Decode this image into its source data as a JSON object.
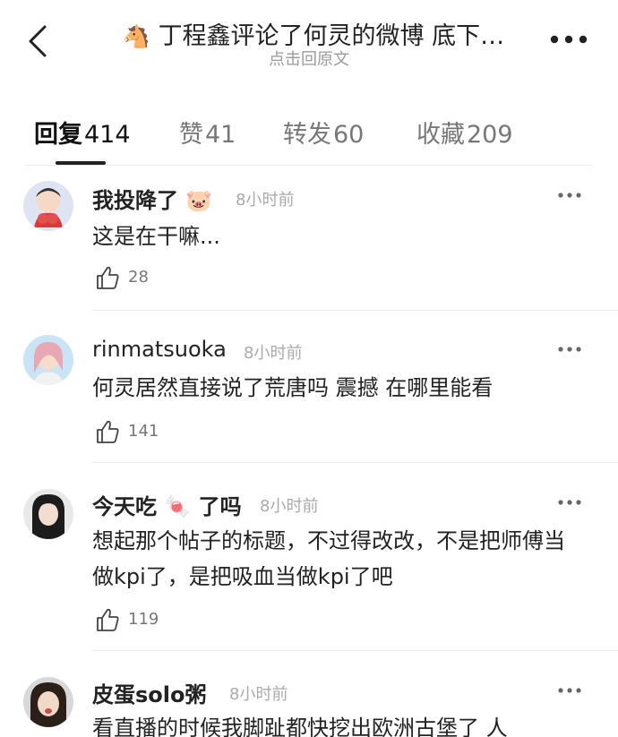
{
  "header": {
    "title_emoji": "🐴",
    "title": "丁程鑫评论了何灵的微博 底下…",
    "subtitle": "点击回原文"
  },
  "tabs": [
    {
      "label": "回复",
      "count": "414",
      "active": true
    },
    {
      "label": "赞",
      "count": "41",
      "active": false
    },
    {
      "label": "转发",
      "count": "60",
      "active": false
    },
    {
      "label": "收藏",
      "count": "209",
      "active": false
    }
  ],
  "comments": [
    {
      "user": "我投降了",
      "user_emoji": "🐷",
      "time": "8小时前",
      "text": "这是在干嘛...",
      "likes": "28"
    },
    {
      "user": "rinmatsuoka",
      "user_emoji": "",
      "time": "8小时前",
      "text": "何灵居然直接说了荒唐吗 震撼 在哪里能看",
      "likes": "141"
    },
    {
      "user": "今天吃",
      "user_emoji": "🍬",
      "user_suffix": "了吗",
      "time": "8小时前",
      "text": "想起那个帖子的标题，不过得改改，不是把师傅当做kpi了，是把吸血当做kpi了吧",
      "likes": "119"
    },
    {
      "user": "皮蛋solo粥",
      "user_emoji": "",
      "time": "8小时前",
      "text": "看直播的时候我脚趾都快挖出欧洲古堡了 人",
      "likes": ""
    }
  ],
  "colors": {
    "text": "#222222",
    "muted": "#9a9a9a",
    "divider": "#ececec"
  }
}
